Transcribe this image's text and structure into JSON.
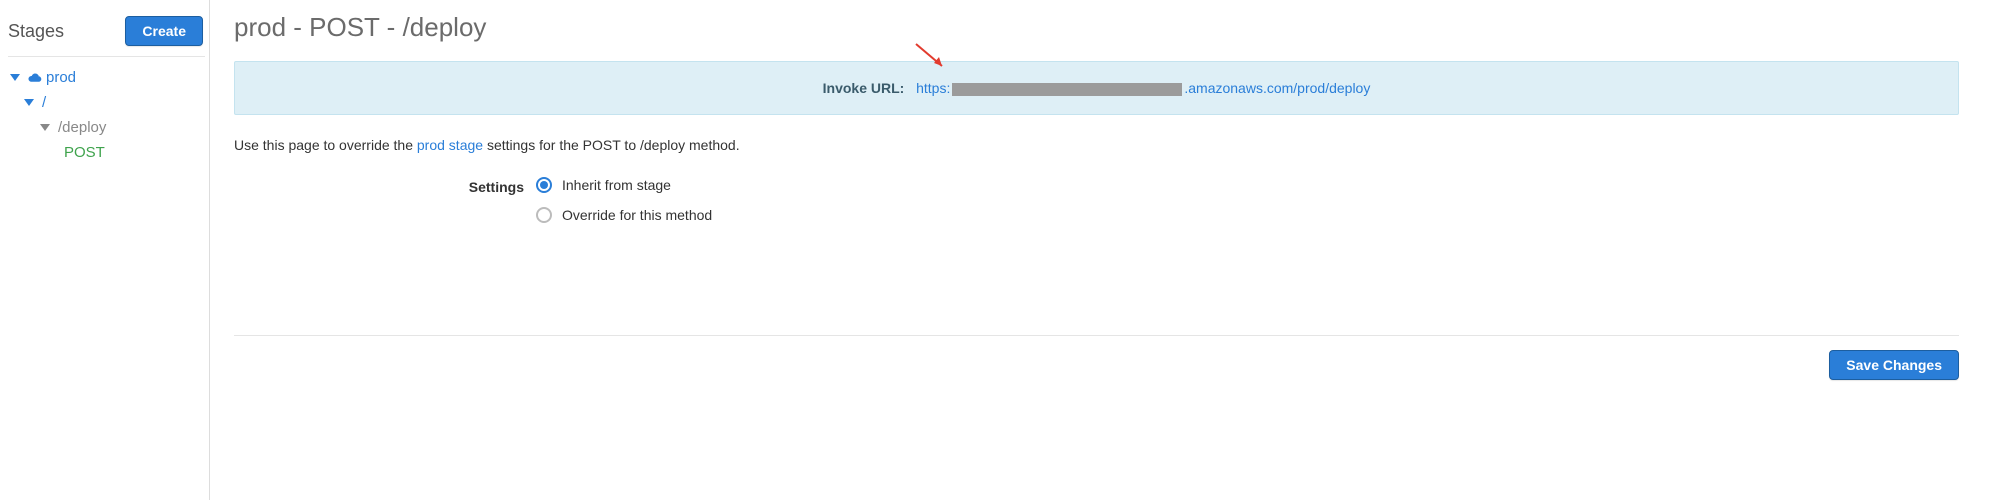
{
  "sidebar": {
    "title": "Stages",
    "create_label": "Create",
    "tree": {
      "stage_label": "prod",
      "root_path_label": "/",
      "resource_label": "/deploy",
      "method_label": "POST"
    }
  },
  "main": {
    "title": "prod - POST - /deploy",
    "invoke_url": {
      "label": "Invoke URL:",
      "prefix": "https:",
      "suffix": ".amazonaws.com/prod/deploy"
    },
    "description": {
      "pre": "Use this page to override the ",
      "link": "prod stage",
      "post": " settings for the POST to /deploy method."
    },
    "settings": {
      "label": "Settings",
      "options": {
        "inherit": "Inherit from stage",
        "override": "Override for this method"
      },
      "selected": "inherit"
    },
    "save_label": "Save Changes"
  }
}
